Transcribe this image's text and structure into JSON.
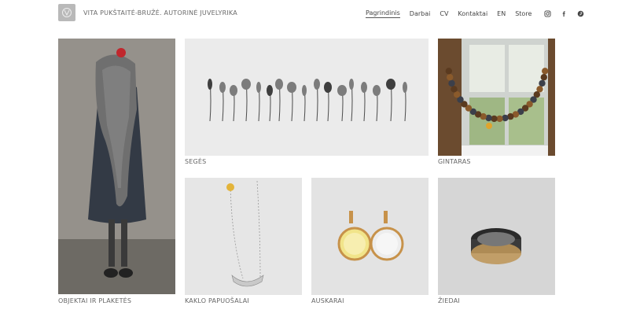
{
  "header": {
    "site_title": "VITA PUKŠTAITĖ-BRUŽĖ. AUTORINĖ JUVELYRIKA",
    "nav": [
      {
        "label": "Pagrindinis",
        "active": true
      },
      {
        "label": "Darbai"
      },
      {
        "label": "CV"
      },
      {
        "label": "Kontaktai"
      },
      {
        "label": "EN"
      },
      {
        "label": "Store"
      }
    ],
    "social_icons": [
      "instagram-icon",
      "facebook-icon",
      "pinterest-icon"
    ]
  },
  "gallery": {
    "objektai": "OBJEKTAI IR PLAKETĖS",
    "seges": "SEGĖS",
    "gintaras": "GINTARAS",
    "kaklo": "KAKLO PAPUOŠALAI",
    "auskarai": "AUSKARAI",
    "ziedai": "ŽIEDAI"
  },
  "colors": {
    "text": "#555555",
    "background": "#ffffff"
  }
}
